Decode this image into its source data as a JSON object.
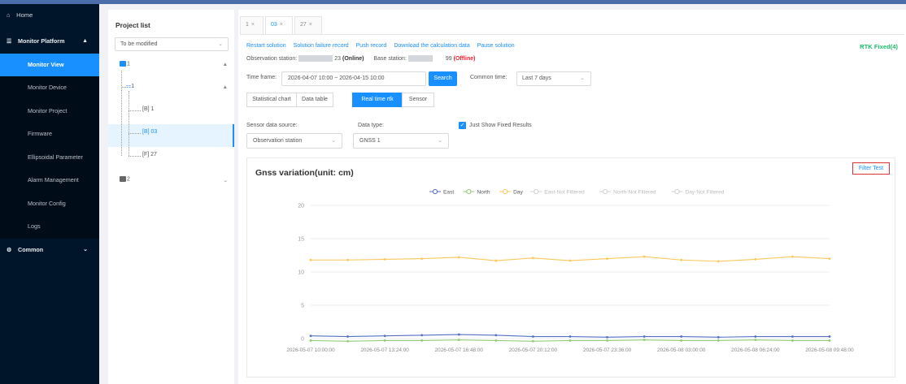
{
  "sidebar": {
    "home": "Home",
    "group": "Monitor Platform",
    "items": [
      {
        "label": "Monitor View",
        "active": true
      },
      {
        "label": "Monitor Device"
      },
      {
        "label": "Monitor Project"
      },
      {
        "label": "Firmware"
      },
      {
        "label": "Ellipsoidal Parameter"
      },
      {
        "label": "Alarm Management"
      },
      {
        "label": "Monitor Config"
      },
      {
        "label": "Logs"
      }
    ],
    "common": "Common"
  },
  "project": {
    "title": "Project list",
    "select_value": "To be modified",
    "tree": {
      "node1": "1",
      "node1_1": "1",
      "leaf_b1": "[B] 1",
      "leaf_b03": "[B] 03",
      "leaf_f27": "[F] 27",
      "node2": "2"
    }
  },
  "tabs": [
    {
      "label": "1",
      "close": "×"
    },
    {
      "label": "03",
      "close": "×",
      "active": true
    },
    {
      "label": "27",
      "close": "×"
    }
  ],
  "actions": [
    "Restart solution",
    "Solution failure record",
    "Push record",
    "Download the calculation data",
    "Pause solution"
  ],
  "rtk_status": "RTK Fixed(4)",
  "stations": {
    "obs_label": "Observation station:",
    "obs_suffix": "23",
    "obs_status": "(Online)",
    "base_label": "Base station:",
    "base_suffix": "99",
    "base_status": "(Offline)"
  },
  "filters": {
    "time_frame_label": "Time frame:",
    "date_range": "2026-04-07 10:00  ~  2026-04-15 10:00",
    "search_label": "Search",
    "common_time_label": "Common time:",
    "common_time_value": "Last 7 days"
  },
  "view_tabs": [
    {
      "label": "Statistical chart"
    },
    {
      "label": "Data table"
    },
    {
      "label": "Real time rtk",
      "active": true
    },
    {
      "label": "Sensor"
    }
  ],
  "source": {
    "label": "Sensor data source:",
    "value": "Observation station",
    "type_label": "Data type:",
    "type_value": "GNSS 1",
    "fixed_only_label": "Just Show Fixed Results",
    "fixed_only_checked": true
  },
  "chart": {
    "filter_button": "Filter Test",
    "colors": {
      "East": "#5470c6",
      "North": "#91cc75",
      "Day": "#fac858",
      "East-Not Filtered": "#d0d0d0",
      "North-Not Filtered": "#d0d0d0",
      "Day-Not Filtered": "#d0d0d0"
    }
  },
  "chart_data": {
    "type": "line",
    "title": "Gnss variation(unit: cm)",
    "xlabel": "",
    "ylabel": "",
    "ylim": [
      0,
      20
    ],
    "yticks": [
      0,
      5,
      10,
      15,
      20
    ],
    "x_ticks": [
      "2026-05-07 10:00:00",
      "2026-05-07 13:24:00",
      "2026-05-07 16:48:00",
      "2026-05-07 20:12:00",
      "2026-05-07 23:36:00",
      "2026-05-08 03:00:00",
      "2026-05-08 06:24:00",
      "2026-05-08 09:48:00"
    ],
    "legend_position": "top-center",
    "grid": true,
    "x": [
      "2026-05-07 10:00",
      "2026-05-07 11:42",
      "2026-05-07 13:24",
      "2026-05-07 15:06",
      "2026-05-07 16:48",
      "2026-05-07 18:30",
      "2026-05-07 20:12",
      "2026-05-07 21:54",
      "2026-05-07 23:36",
      "2026-05-08 01:18",
      "2026-05-08 03:00",
      "2026-05-08 04:42",
      "2026-05-08 06:24",
      "2026-05-08 08:06",
      "2026-05-08 09:48"
    ],
    "series": [
      {
        "name": "East",
        "values": [
          0.4,
          0.3,
          0.4,
          0.5,
          0.6,
          0.5,
          0.3,
          0.3,
          0.2,
          0.3,
          0.3,
          0.2,
          0.3,
          0.3,
          0.3
        ]
      },
      {
        "name": "North",
        "values": [
          -0.3,
          -0.4,
          -0.3,
          -0.3,
          -0.2,
          -0.3,
          -0.4,
          -0.3,
          -0.3,
          -0.2,
          -0.3,
          -0.3,
          -0.2,
          -0.3,
          -0.3
        ]
      },
      {
        "name": "Day",
        "values": [
          11.8,
          11.8,
          11.9,
          12.0,
          12.2,
          11.7,
          12.1,
          11.7,
          12.0,
          12.3,
          11.8,
          11.6,
          11.9,
          12.3,
          12.0
        ]
      },
      {
        "name": "East-Not Filtered",
        "values": []
      },
      {
        "name": "North-Not Filtered",
        "values": []
      },
      {
        "name": "Day-Not Filtered",
        "values": []
      }
    ]
  }
}
